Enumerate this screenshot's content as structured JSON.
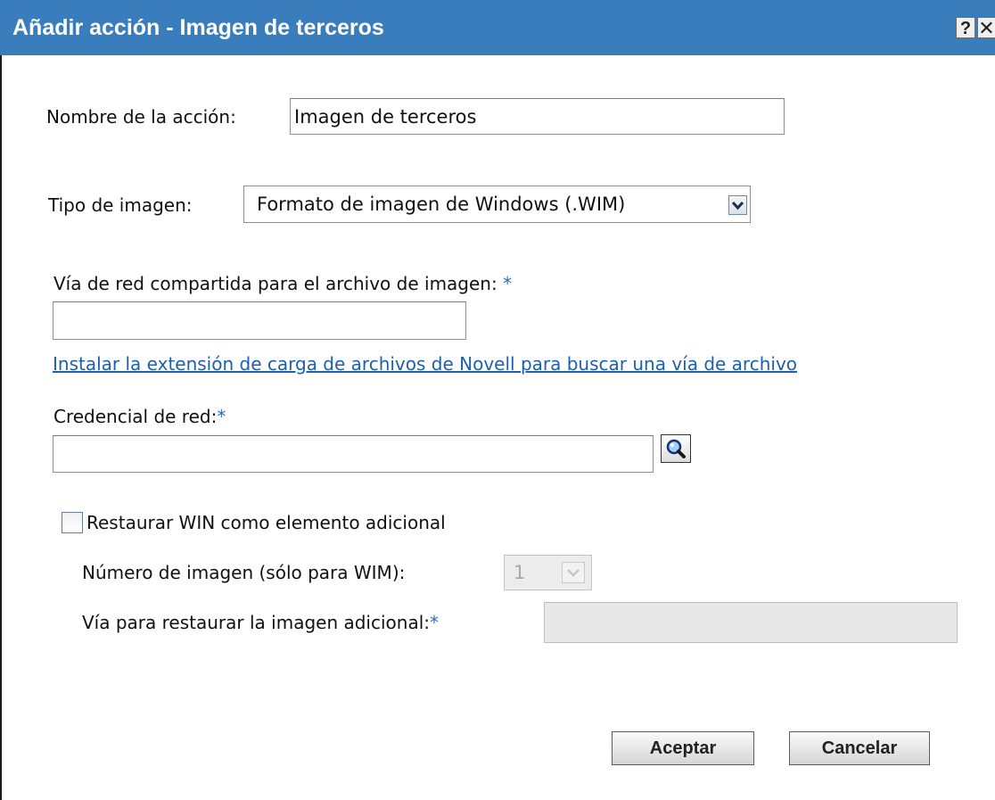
{
  "dialog": {
    "title": "Añadir acción - Imagen de terceros",
    "help_label": "?",
    "close_label": "✕"
  },
  "form": {
    "action_name_label": "Nombre de la acción:",
    "action_name_value": "Imagen de terceros",
    "image_type_label": "Tipo de imagen:",
    "image_type_value": "Formato de imagen de Windows (.WIM)",
    "share_path_label": "Vía de red compartida para el archivo de imagen:",
    "share_path_value": "",
    "install_extension_link": "Instalar la extensión de carga de archivos de Novell para buscar una vía de archivo",
    "credential_label": "Credencial de red:",
    "credential_value": "",
    "required_marker": "*",
    "restore_checkbox_label": "Restaurar WIN como elemento adicional",
    "restore_checked": false,
    "image_number_label": "Número de imagen (sólo para WIM):",
    "image_number_value": "1",
    "restore_path_label": "Vía para restaurar la imagen adicional:",
    "restore_path_value": ""
  },
  "buttons": {
    "ok_label": "Aceptar",
    "cancel_label": "Cancelar"
  },
  "colors": {
    "titlebar": "#3a7dbd",
    "link": "#1d5fb0",
    "required": "#2c6db8"
  },
  "icons": {
    "search": "magnifier-icon",
    "dropdown": "chevron-down-icon"
  }
}
